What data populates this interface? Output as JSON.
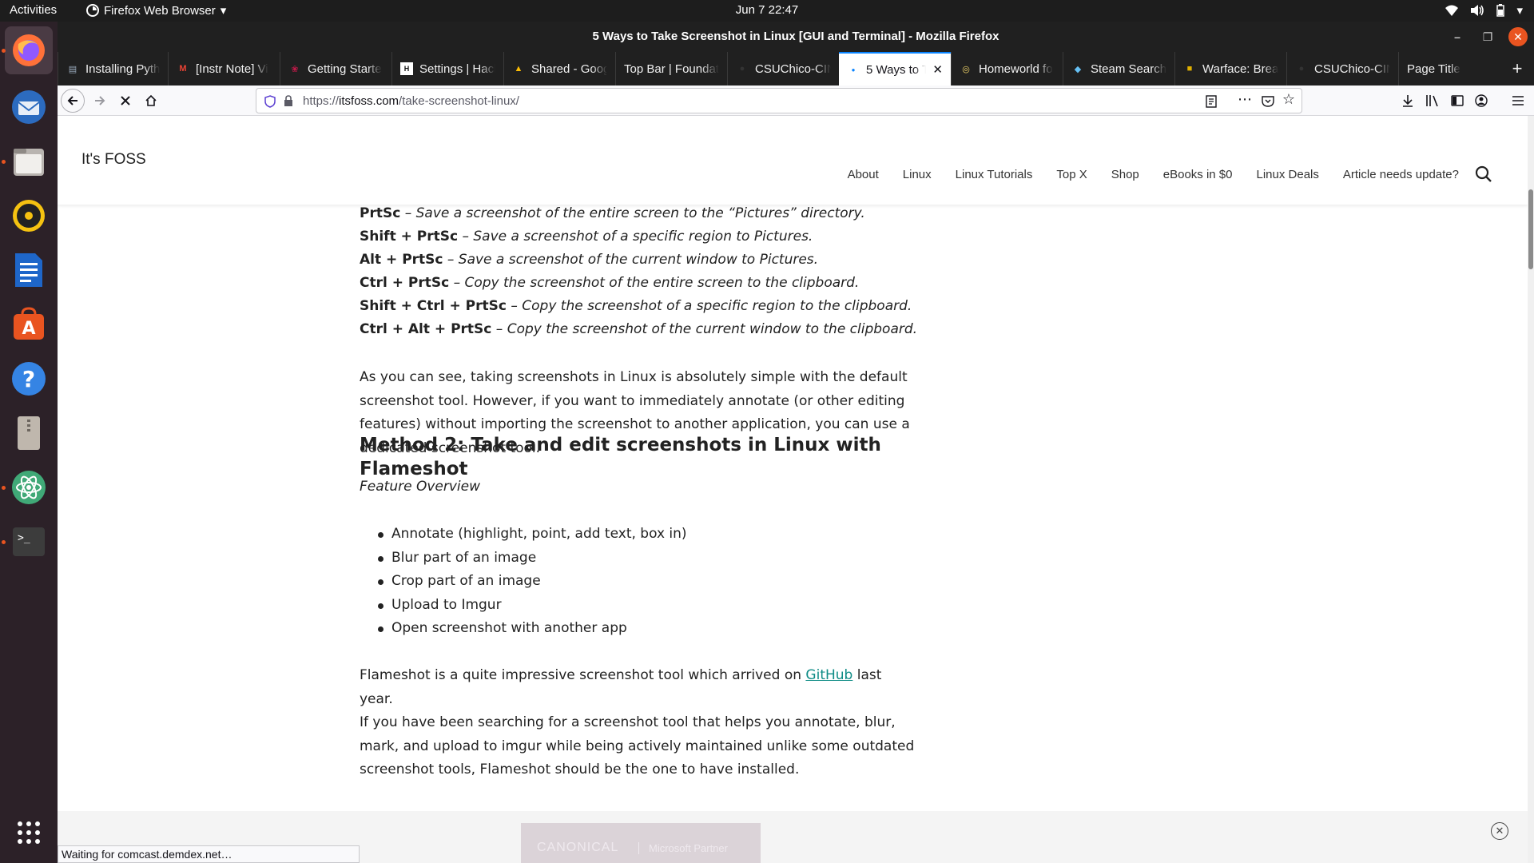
{
  "topbar": {
    "activities": "Activities",
    "app_name": "Firefox Web Browser",
    "clock": "Jun 7  22:47"
  },
  "dock": {
    "items": [
      "firefox",
      "thunderbird",
      "files",
      "rhythmbox",
      "libreoffice-writer",
      "ubuntu-software",
      "help",
      "archive-manager",
      "atom",
      "terminal"
    ],
    "show_apps": "show-applications"
  },
  "window": {
    "title": "5 Ways to Take Screenshot in Linux [GUI and Terminal] - Mozilla Firefox"
  },
  "tabs": [
    {
      "label": "Installing Pyth",
      "icon": "page-icon"
    },
    {
      "label": "[Instr Note] Vi",
      "icon": "gmail-icon"
    },
    {
      "label": "Getting Starte",
      "icon": "raspberry-icon"
    },
    {
      "label": "Settings | Hack",
      "icon": "hackerrank-icon"
    },
    {
      "label": "Shared - Goog",
      "icon": "drive-icon"
    },
    {
      "label": "Top Bar | Foundat",
      "icon": ""
    },
    {
      "label": "CSUChico-CIN",
      "icon": "github-icon"
    },
    {
      "label": "5 Ways to Ta",
      "icon": "dot-icon"
    },
    {
      "label": "Homeworld fo",
      "icon": "homeworld-icon"
    },
    {
      "label": "Steam Search",
      "icon": "steam-icon"
    },
    {
      "label": "Warface: Brea",
      "icon": "warface-icon"
    },
    {
      "label": "CSUChico-CIN",
      "icon": "github-icon"
    },
    {
      "label": "Page Title",
      "icon": ""
    }
  ],
  "navbar": {
    "url_prefix": "https://",
    "url_host": "itsfoss.com",
    "url_path": "/take-screenshot-linux/"
  },
  "site": {
    "name": "It's FOSS",
    "nav": [
      "About",
      "Linux",
      "Linux Tutorials",
      "Top X",
      "Shop",
      "eBooks in $0",
      "Linux Deals",
      "Article needs update?"
    ]
  },
  "article": {
    "shortcuts": [
      {
        "key": "PrtSc",
        "desc": " – Save a screenshot of the entire screen to the “Pictures” directory."
      },
      {
        "key": "Shift + PrtSc",
        "desc": " – Save a screenshot of a specific region to Pictures."
      },
      {
        "key": "Alt + PrtSc",
        "desc": "  – Save a screenshot of the current window to Pictures."
      },
      {
        "key": "Ctrl + PrtSc",
        "desc": " – Copy the screenshot of the entire screen to the clipboard."
      },
      {
        "key": "Shift + Ctrl + PrtSc",
        "desc": " – Copy the screenshot of a specific region to the clipboard."
      },
      {
        "key": "Ctrl + Alt + PrtSc",
        "desc": " – Copy the screenshot of the current window to the clipboard."
      }
    ],
    "para1": "As you can see, taking screenshots in Linux is absolutely simple with the default screenshot tool. However, if you want to immediately annotate (or other editing features) without importing the screenshot to another application, you can use a dedicated screenshot tool.",
    "heading": "Method 2: Take and edit screenshots in Linux with Flameshot",
    "feature_label": "Feature Overview",
    "features": [
      "Annotate (highlight, point, add text, box in)",
      "Blur part of an image",
      "Crop part of an image",
      "Upload to Imgur",
      "Open screenshot with another app"
    ],
    "para2_before": "Flameshot is a quite impressive screenshot tool which arrived on ",
    "para2_link": "GitHub",
    "para2_after": " last year.",
    "para3": "If you have been searching for a screenshot tool that helps you annotate, blur, mark, and upload to imgur while being actively maintained unlike some outdated screenshot tools, Flameshot should be the one to have installed."
  },
  "ad": {
    "brand": "CANONICAL",
    "partner": "Microsoft Partner"
  },
  "status": "Waiting for comcast.demdex.net…"
}
